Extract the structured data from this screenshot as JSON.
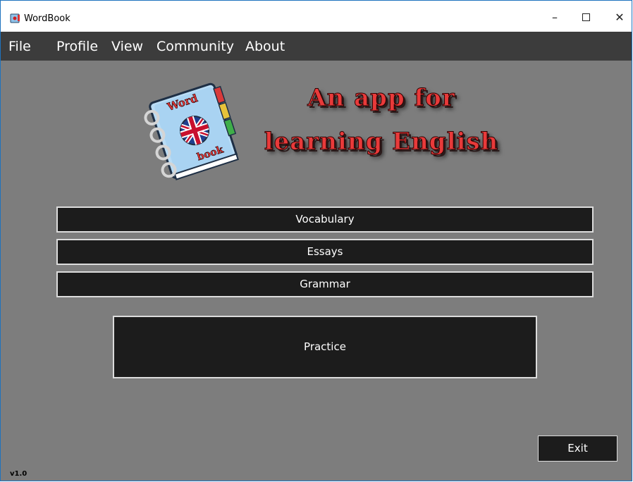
{
  "window": {
    "title": "WordBook",
    "app_icon": "book-icon",
    "controls": {
      "minimize": "–",
      "maximize": "maximize-icon",
      "close": "✕"
    }
  },
  "menu": {
    "items": [
      "File",
      "Profile",
      "View",
      "Community",
      "About"
    ]
  },
  "logo": {
    "top_word": "Word",
    "bottom_word": "book",
    "flag": "uk-flag-icon"
  },
  "tagline": {
    "line1": "An app for",
    "line2": "learning English"
  },
  "buttons": {
    "vocabulary": "Vocabulary",
    "essays": "Essays",
    "grammar": "Grammar",
    "practice": "Practice",
    "exit": "Exit"
  },
  "version": "v1.0",
  "colors": {
    "background": "#7d7d7d",
    "menubar": "#3c3c3c",
    "button_fill": "#1c1c1c",
    "tagline_red": "#e83a3a"
  }
}
